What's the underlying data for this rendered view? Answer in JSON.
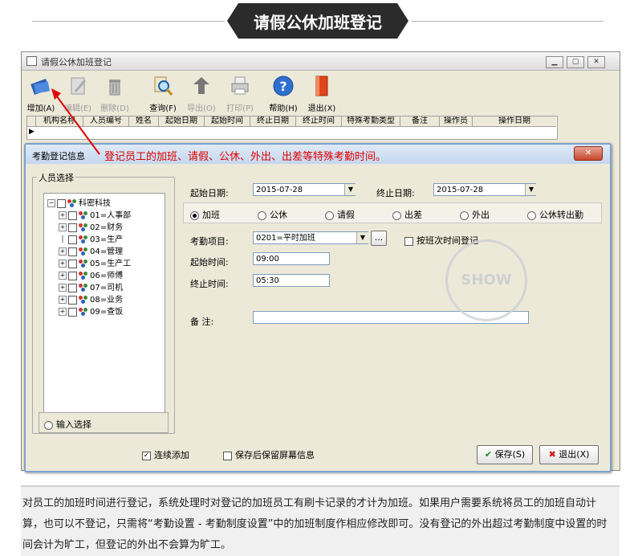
{
  "banner": {
    "title": "请假公休加班登记"
  },
  "window": {
    "title": "请假公休加班登记",
    "controls": [
      "▁",
      "▢",
      "✕"
    ]
  },
  "toolbar": [
    {
      "label": "增加(A)",
      "icon": "books-icon",
      "enabled": true
    },
    {
      "label": "编辑(E)",
      "icon": "edit-icon",
      "enabled": false
    },
    {
      "label": "删除(D)",
      "icon": "trash-icon",
      "enabled": false
    },
    {
      "label": "查询(F)",
      "icon": "search-icon",
      "enabled": true
    },
    {
      "label": "导出(O)",
      "icon": "export-icon",
      "enabled": false
    },
    {
      "label": "打印(P)",
      "icon": "printer-icon",
      "enabled": false
    },
    {
      "label": "帮助(H)",
      "icon": "help-icon",
      "enabled": true
    },
    {
      "label": "退出(X)",
      "icon": "exit-icon",
      "enabled": true
    }
  ],
  "grid": {
    "columns": [
      "机构名称",
      "人员编号",
      "姓名",
      "起始日期",
      "起始时间",
      "终止日期",
      "终止时间",
      "特殊考勤类型",
      "备注",
      "操作员",
      "操作日期"
    ]
  },
  "dialog": {
    "title": "考勤登记信息",
    "close": "✕",
    "annotation": "登记员工的加班、请假、公休、外出、出差等特殊考勤时间。",
    "person_group": "人员选择",
    "tree": {
      "root": "科密科技",
      "children": [
        "01=人事部",
        "02=财务",
        "03=生产",
        "04=管理",
        "05=生产工",
        "06=师傅",
        "07=司机",
        "08=业务",
        "09=查饭"
      ]
    },
    "input_select": "输入选择",
    "start_date_label": "起始日期:",
    "start_date": "2015-07-28",
    "end_date_label": "终止日期:",
    "end_date": "2015-07-28",
    "types": [
      "加班",
      "公休",
      "请假",
      "出差",
      "外出",
      "公休转出勤"
    ],
    "selected_type": "加班",
    "item_label": "考勤项目:",
    "item_value": "0201=平时加班",
    "item_browse": "...",
    "by_shift_label": "按班次时间登记",
    "start_time_label": "起始时间:",
    "start_time": "09:00",
    "end_time_label": "终止时间:",
    "end_time": "05:30",
    "remark_label": "备    注:",
    "remark": "",
    "continuous_add": "连续添加",
    "keep_screen": "保存后保留屏幕信息",
    "save": "保存(S)",
    "exit": "退出(X)"
  },
  "watermark": "SHOW",
  "description": "对员工的加班时间进行登记，系统处理时对登记的加班员工有刷卡记录的才计为加班。如果用户需要系统将员工的加班自动计算，也可以不登记，只需将“考勤设置 - 考勤制度设置”中的加班制度作相应修改即可。没有登记的外出超过考勤制度中设置的时间会计为旷工，但登记的外出不会算为旷工。",
  "colors": {
    "annotation": "#e00000",
    "dialog_border": "#7da2ce",
    "window_bg": "#ece9d8"
  }
}
